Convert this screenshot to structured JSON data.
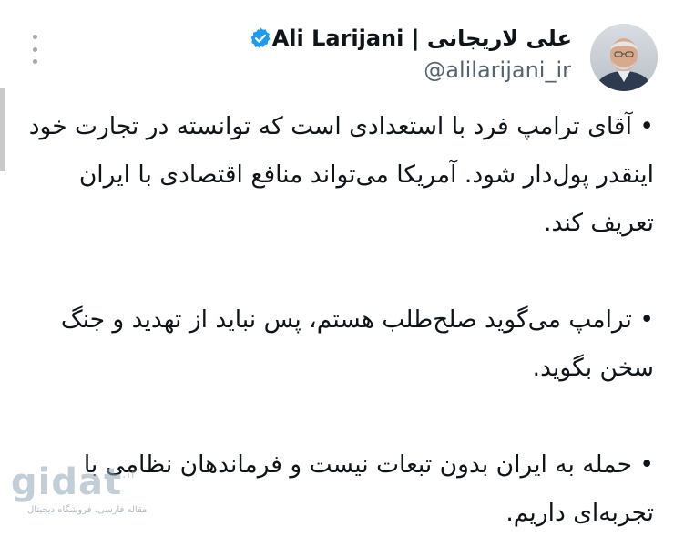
{
  "tweet": {
    "display_name": "Ali Larijani | علی لاریجانی",
    "handle": "@alilarijani_ir",
    "verified": true,
    "more_icon": "vertical-ellipsis-icon",
    "paragraphs": [
      "• آقای ترامپ فرد با استعدادی است که توانسته در تجارت خود اینقدر پول‌دار شود. آمریکا می‌تواند منافع اقتصادی با ایران تعریف کند.",
      "• ترامپ می‌گوید صلح‌طلب هستم، پس نباید از تهدید و جنگ سخن بگوید.",
      "• حمله به ایران بدون تبعات نیست و فرماندهان نظامی با تجربه‌ای داریم."
    ]
  },
  "watermark": {
    "logo": "gidat",
    "tld": ".ir",
    "tagline": "مقاله فارسی، فروشگاه دیجیتال"
  },
  "colors": {
    "text": "#0f1419",
    "secondary": "#536471",
    "verified": "#1d9bf0"
  }
}
